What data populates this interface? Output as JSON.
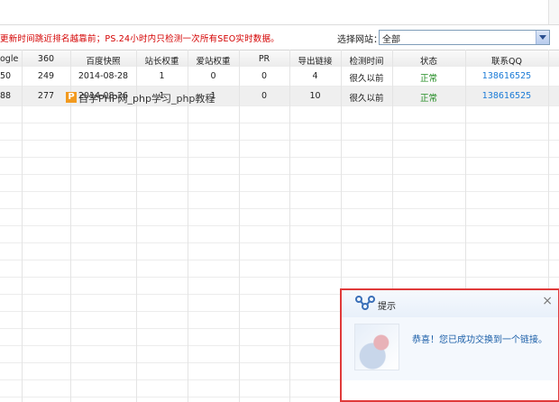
{
  "notice": "更新时间跳近排名越靠前；PS.24小时内只检测一次所有SEO实时数据。",
  "site_select": {
    "label": "选择网站：",
    "value": "全部"
  },
  "table": {
    "headers": [
      "ogle",
      "360",
      "百度快照",
      "站长权重",
      "爱站权重",
      "PR",
      "导出链接",
      "检测时间",
      "状态",
      "联系QQ"
    ],
    "rows": [
      [
        "50",
        "249",
        "2014-08-28",
        "1",
        "0",
        "0",
        "4",
        "很久以前",
        "正常",
        "138616525"
      ],
      [
        "88",
        "277",
        "2014-08-26",
        "1",
        "1",
        "0",
        "10",
        "很久以前",
        "正常",
        "138616525"
      ]
    ]
  },
  "popup": {
    "title": "提示",
    "close": "×",
    "message": "恭喜！您已成功交换到一个链接。",
    "watermark_logo": "P",
    "watermark_text": "自学PHP网_php学习_php教程"
  }
}
